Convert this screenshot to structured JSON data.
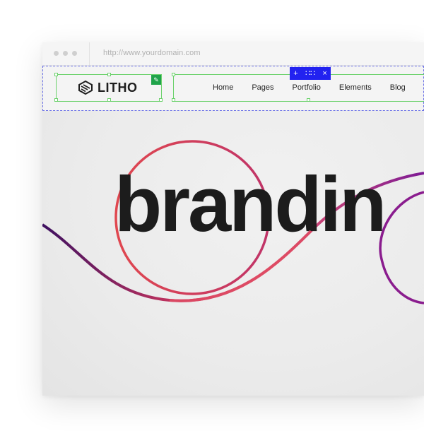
{
  "browser": {
    "url": "http://www.yourdomain.com"
  },
  "header": {
    "logo_text": "LITHO",
    "nav": [
      "Home",
      "Pages",
      "Portfolio",
      "Elements",
      "Blog"
    ],
    "toolbar": {
      "add": "+",
      "move": "∷∷",
      "close": "×"
    }
  },
  "hero": {
    "word": "brandin"
  },
  "colors": {
    "builder_accent": "#2222f0",
    "selection_green": "#6bd16b",
    "curve_pink": "#e9516b",
    "curve_purple": "#8a1c8e"
  }
}
